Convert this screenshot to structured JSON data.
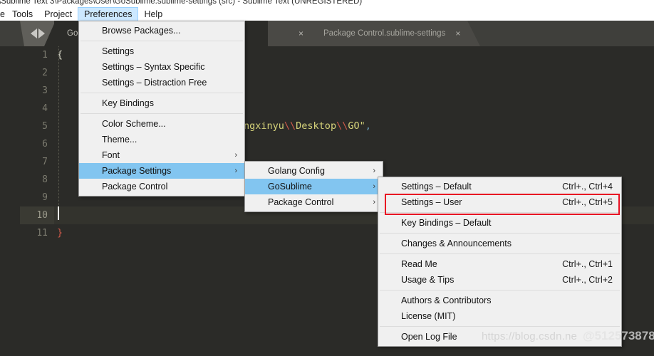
{
  "window": {
    "title": "\\Sublime Text 3\\Packages\\User\\GoSublime.sublime-settings (src) - Sublime Text (UNREGISTERED)"
  },
  "menubar": {
    "items": [
      {
        "label": "e",
        "active": false,
        "partial": true
      },
      {
        "label": "Tools",
        "active": false
      },
      {
        "label": "Project",
        "active": false
      },
      {
        "label": "Preferences",
        "active": true
      },
      {
        "label": "Help",
        "active": false
      }
    ]
  },
  "tabs": {
    "nav_prev_icon": "arrow-left-icon",
    "nav_next_icon": "arrow-right-icon",
    "items": [
      {
        "label": "GoS",
        "close": "×",
        "active": true
      },
      {
        "label": "",
        "close": "×",
        "active": false
      },
      {
        "label": "Package Control.sublime-settings",
        "close": "×",
        "active": false
      }
    ]
  },
  "editor": {
    "line_numbers": [
      "1",
      "2",
      "3",
      "4",
      "5",
      "6",
      "7",
      "8",
      "9",
      "10",
      "11"
    ],
    "current_line": "10",
    "lines": [
      {
        "n": "1",
        "tokens": [
          {
            "t": "{",
            "c": "tok-punc"
          }
        ]
      },
      {
        "n": "2",
        "tokens": []
      },
      {
        "n": "3",
        "tokens": []
      },
      {
        "n": "4",
        "tokens": []
      },
      {
        "n": "5",
        "tokens": [
          {
            "t": "ngxinyu",
            "c": "tok-str"
          },
          {
            "t": "\\\\",
            "c": "tok-esc"
          },
          {
            "t": "Desktop",
            "c": "tok-str"
          },
          {
            "t": "\\\\",
            "c": "tok-esc"
          },
          {
            "t": "GO\"",
            "c": "tok-str"
          },
          {
            "t": ",",
            "c": "tok-comma"
          }
        ]
      },
      {
        "n": "6",
        "tokens": []
      },
      {
        "n": "7",
        "tokens": []
      },
      {
        "n": "8",
        "tokens": []
      },
      {
        "n": "9",
        "tokens": []
      },
      {
        "n": "10",
        "tokens": []
      },
      {
        "n": "11",
        "tokens": [
          {
            "t": "}",
            "c": "tok-esc"
          }
        ]
      }
    ]
  },
  "menus": {
    "preferences": {
      "name": "Preferences",
      "items": [
        {
          "label": "Browse Packages...",
          "shortcut": "",
          "submenu": false,
          "selected": false
        },
        {
          "separator": true
        },
        {
          "label": "Settings",
          "shortcut": "",
          "submenu": false,
          "selected": false
        },
        {
          "label": "Settings – Syntax Specific",
          "shortcut": "",
          "submenu": false,
          "selected": false
        },
        {
          "label": "Settings – Distraction Free",
          "shortcut": "",
          "submenu": false,
          "selected": false
        },
        {
          "separator": true
        },
        {
          "label": "Key Bindings",
          "shortcut": "",
          "submenu": false,
          "selected": false
        },
        {
          "separator": true
        },
        {
          "label": "Color Scheme...",
          "shortcut": "",
          "submenu": false,
          "selected": false
        },
        {
          "label": "Theme...",
          "shortcut": "",
          "submenu": false,
          "selected": false
        },
        {
          "label": "Font",
          "shortcut": "",
          "submenu": true,
          "selected": false
        },
        {
          "label": "Package Settings",
          "shortcut": "",
          "submenu": true,
          "selected": true
        },
        {
          "label": "Package Control",
          "shortcut": "",
          "submenu": false,
          "selected": false
        }
      ]
    },
    "package_settings": {
      "name": "Package Settings",
      "items": [
        {
          "label": "Golang Config",
          "shortcut": "",
          "submenu": true,
          "selected": false
        },
        {
          "label": "GoSublime",
          "shortcut": "",
          "submenu": true,
          "selected": true
        },
        {
          "label": "Package Control",
          "shortcut": "",
          "submenu": true,
          "selected": false
        }
      ]
    },
    "gosublime": {
      "name": "GoSublime",
      "items": [
        {
          "label": "Settings – Default",
          "shortcut": "Ctrl+., Ctrl+4",
          "submenu": false,
          "selected": false
        },
        {
          "label": "Settings – User",
          "shortcut": "Ctrl+., Ctrl+5",
          "submenu": false,
          "selected": false,
          "highlighted": true
        },
        {
          "separator": true
        },
        {
          "label": "Key Bindings – Default",
          "shortcut": "",
          "submenu": false,
          "selected": false
        },
        {
          "separator": true
        },
        {
          "label": "Changes & Announcements",
          "shortcut": "",
          "submenu": false,
          "selected": false
        },
        {
          "separator": true
        },
        {
          "label": "Read Me",
          "shortcut": "Ctrl+., Ctrl+1",
          "submenu": false,
          "selected": false
        },
        {
          "label": "Usage & Tips",
          "shortcut": "Ctrl+., Ctrl+2",
          "submenu": false,
          "selected": false
        },
        {
          "separator": true
        },
        {
          "label": "Authors & Contributors",
          "shortcut": "",
          "submenu": false,
          "selected": false
        },
        {
          "label": "License (MIT)",
          "shortcut": "",
          "submenu": false,
          "selected": false
        },
        {
          "separator": true
        },
        {
          "label": "Open Log File",
          "shortcut": "",
          "submenu": false,
          "selected": false
        }
      ]
    }
  },
  "annotations": {
    "highlight_color": "#e81123",
    "selection_color": "#82c5f0",
    "menubar_active_color": "#cce8ff"
  },
  "watermark": {
    "url": "https://blog.csdn.ne",
    "id": "@512573878"
  }
}
